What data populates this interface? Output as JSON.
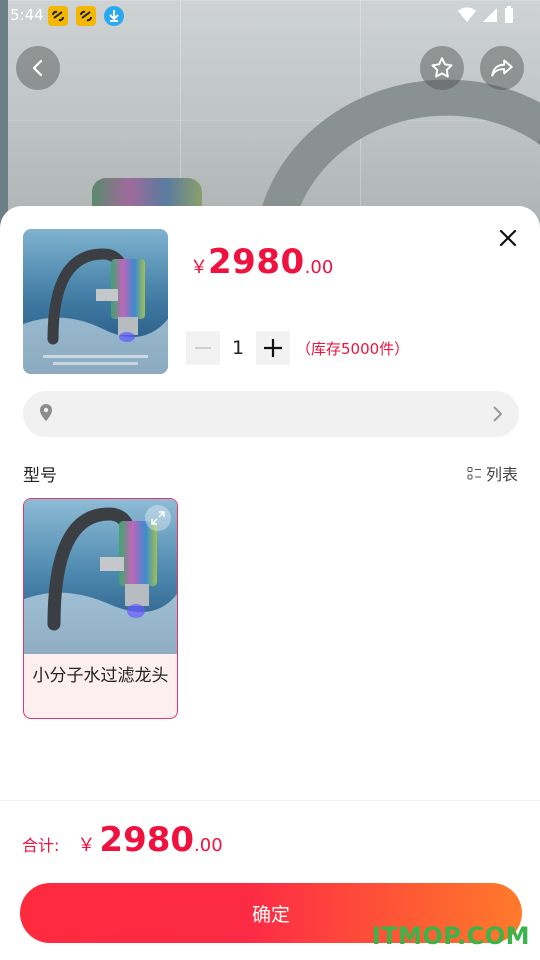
{
  "status_bar": {
    "time": "5:44"
  },
  "product": {
    "price_symbol": "￥",
    "price_int": "2980",
    "price_dec": ".00",
    "quantity": "1",
    "stock_text": "（库存5000件）"
  },
  "variants": {
    "section_title": "型号",
    "list_mode_label": "列表",
    "items": [
      {
        "label": "小分子水过滤龙头"
      }
    ]
  },
  "footer": {
    "total_label": "合计:",
    "total_symbol": "￥",
    "total_int": "2980",
    "total_dec": ".00",
    "confirm_label": "确定"
  },
  "watermark": "ITMOP.COM",
  "colors": {
    "accent": "#f0123e",
    "button_start": "#fe2b3f",
    "button_end": "#ff7a2a",
    "card_border": "#e3366a"
  }
}
